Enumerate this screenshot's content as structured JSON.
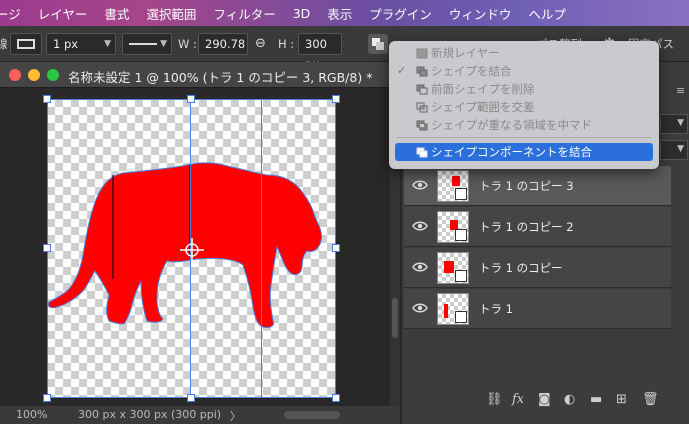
{
  "menubar": {
    "items": [
      "ージ",
      "レイヤー",
      "書式",
      "選択範囲",
      "フィルター",
      "3D",
      "表示",
      "プラグイン",
      "ウィンドウ",
      "ヘルプ"
    ]
  },
  "options": {
    "stroke_label": "線 :",
    "stroke_width": "1 px",
    "width_label": "W :",
    "width_value": "290.78",
    "height_label": "H :",
    "height_value": "300 px",
    "right_label_1": "パス整列",
    "right_label_2": "固定パス"
  },
  "document": {
    "title": "名称未設定 1 @ 100% (トラ 1 のコピー 3, RGB/8) *",
    "zoom": "100%",
    "info": "300 px x 300 px (300 ppi)",
    "info_arrow": "〉"
  },
  "path_menu": {
    "items": [
      {
        "label": "新規レイヤー",
        "checked": false,
        "highlighted": false
      },
      {
        "label": "シェイプを結合",
        "checked": true,
        "highlighted": false
      },
      {
        "label": "前面シェイプを削除",
        "checked": false,
        "highlighted": false
      },
      {
        "label": "シェイプ範囲を交差",
        "checked": false,
        "highlighted": false
      },
      {
        "label": "シェイプが重なる領域を中マド",
        "checked": false,
        "highlighted": false
      },
      {
        "label": "シェイプコンポーネントを結合",
        "checked": false,
        "highlighted": true
      }
    ],
    "check_mark": "✓"
  },
  "layers": [
    {
      "name": "トラ 1 のコピー 3",
      "selected": true
    },
    {
      "name": "トラ 1 のコピー 2",
      "selected": false
    },
    {
      "name": "トラ 1 のコピー",
      "selected": false
    },
    {
      "name": "トラ 1",
      "selected": false
    }
  ],
  "colors": {
    "shape_fill": "#ff0000",
    "selection_blue": "#2a6fdb",
    "path_outline": "#4a7fe0"
  },
  "panel_bottom_icons": [
    "link-icon",
    "fx-icon",
    "mask-icon",
    "adjustment-icon",
    "folder-icon",
    "new-layer-icon",
    "trash-icon"
  ],
  "panel_bottom_labels": {
    "fx": "fx"
  }
}
